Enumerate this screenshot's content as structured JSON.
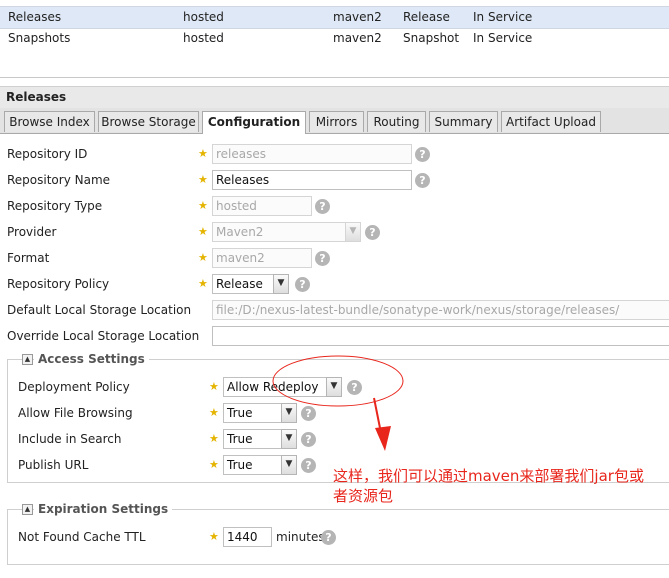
{
  "grid": {
    "rows": [
      {
        "name": "Releases",
        "type": "hosted",
        "format": "maven2",
        "policy": "Release",
        "status": "In Service"
      },
      {
        "name": "Snapshots",
        "type": "hosted",
        "format": "maven2",
        "policy": "Snapshot",
        "status": "In Service"
      }
    ]
  },
  "panel": {
    "title": "Releases"
  },
  "tabs": [
    "Browse Index",
    "Browse Storage",
    "Configuration",
    "Mirrors",
    "Routing",
    "Summary",
    "Artifact Upload"
  ],
  "form": {
    "repo_id": {
      "label": "Repository ID",
      "value": "releases"
    },
    "repo_name": {
      "label": "Repository Name",
      "value": "Releases"
    },
    "repo_type": {
      "label": "Repository Type",
      "value": "hosted"
    },
    "provider": {
      "label": "Provider",
      "value": "Maven2"
    },
    "format": {
      "label": "Format",
      "value": "maven2"
    },
    "policy": {
      "label": "Repository Policy",
      "value": "Release"
    },
    "default_storage": {
      "label": "Default Local Storage Location",
      "value": "file:/D:/nexus-latest-bundle/sonatype-work/nexus/storage/releases/"
    },
    "override_storage": {
      "label": "Override Local Storage Location",
      "value": ""
    }
  },
  "access": {
    "legend": "Access Settings",
    "deployment_policy": {
      "label": "Deployment Policy",
      "value": "Allow Redeploy"
    },
    "file_browsing": {
      "label": "Allow File Browsing",
      "value": "True"
    },
    "include_search": {
      "label": "Include in Search",
      "value": "True"
    },
    "publish_url": {
      "label": "Publish URL",
      "value": "True"
    }
  },
  "expiration": {
    "legend": "Expiration Settings",
    "not_found_ttl": {
      "label": "Not Found Cache TTL",
      "value": "1440",
      "unit": "minutes"
    }
  },
  "icons": {
    "help": "?",
    "collapse": "▲",
    "dropdown": "▼",
    "required": "★"
  },
  "annotation": {
    "line1": "这样，我们可以通过maven来部署我们jar包或",
    "line2": "者资源包",
    "color": "#e8261c"
  }
}
